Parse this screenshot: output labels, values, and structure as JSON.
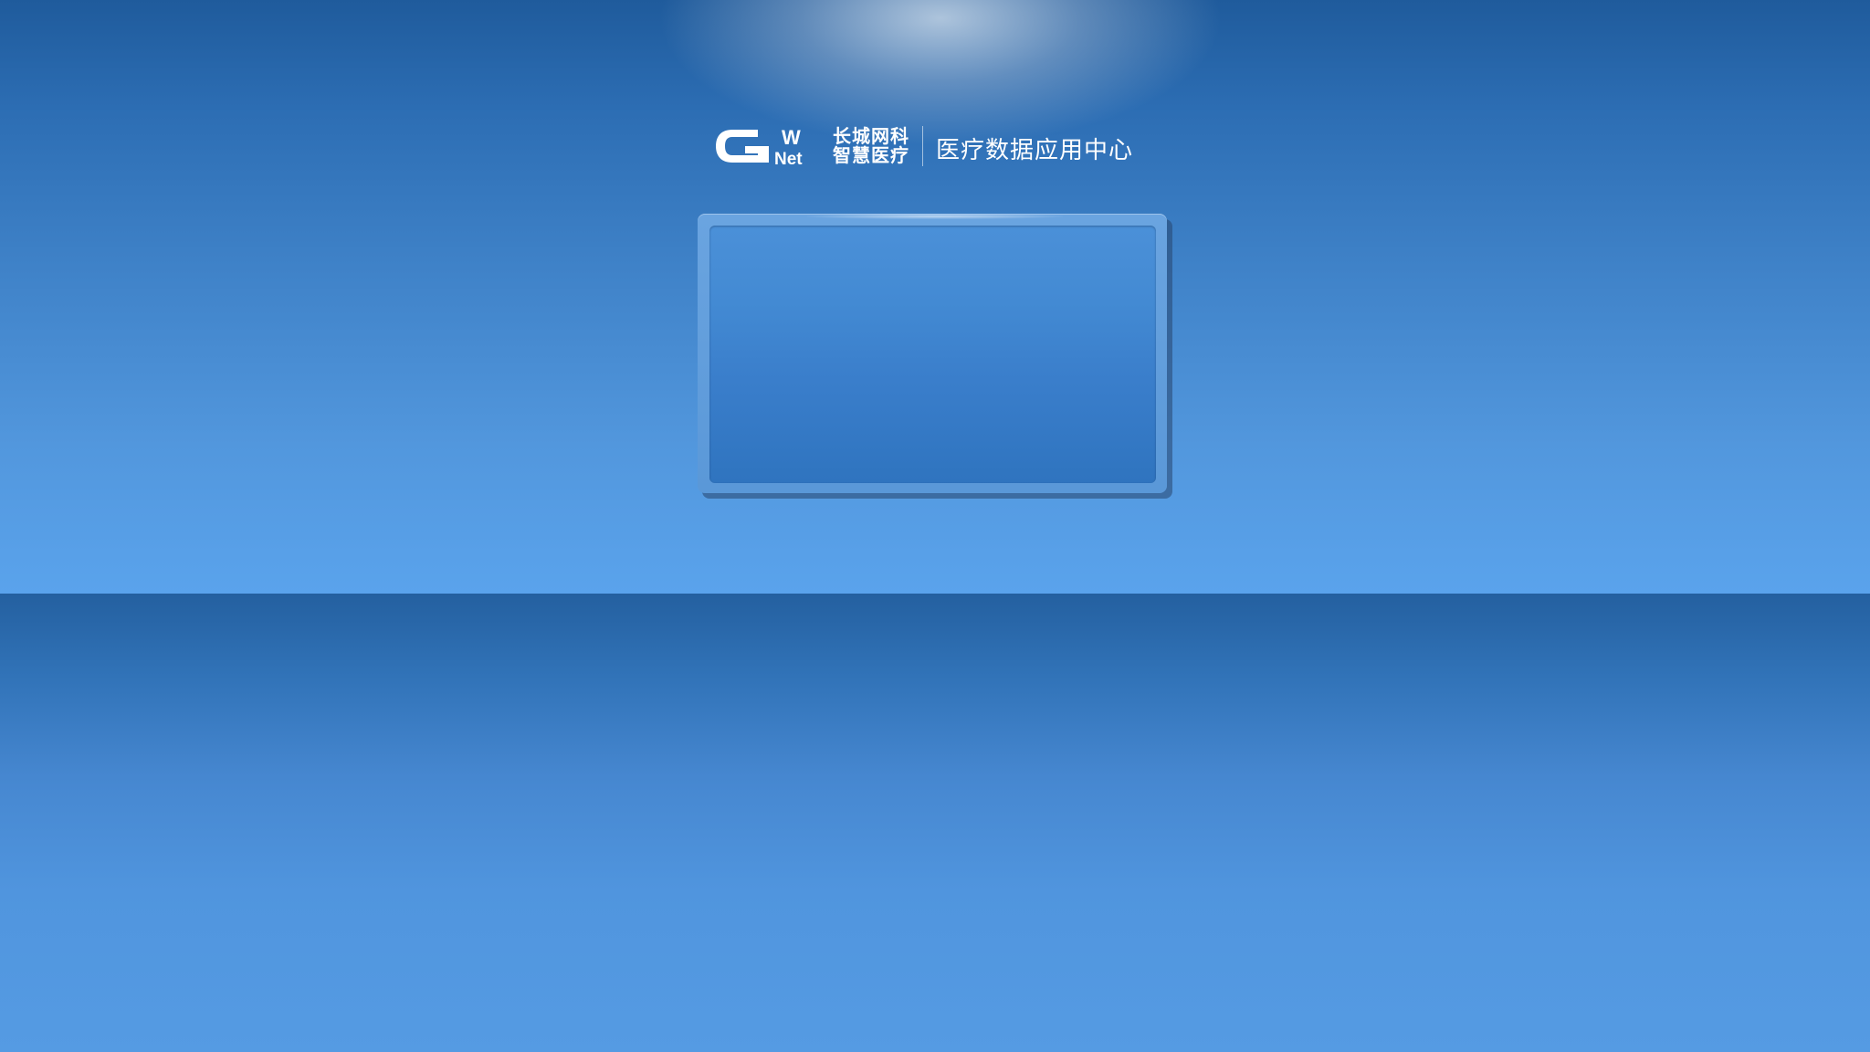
{
  "brand": {
    "logo_icon": "gwnet-logo-icon",
    "logo_text_top": "W",
    "logo_text_bottom": "Net",
    "company_line_1": "长城网科",
    "company_line_2": "智慧医疗",
    "system_title": "医疗数据应用中心"
  },
  "colors": {
    "background_top": "#1f5b9c",
    "background_horizon": "#5aa3ec",
    "panel_border": "#5a98d8",
    "panel_fill": "#3a7ecb",
    "text": "#ffffff"
  }
}
